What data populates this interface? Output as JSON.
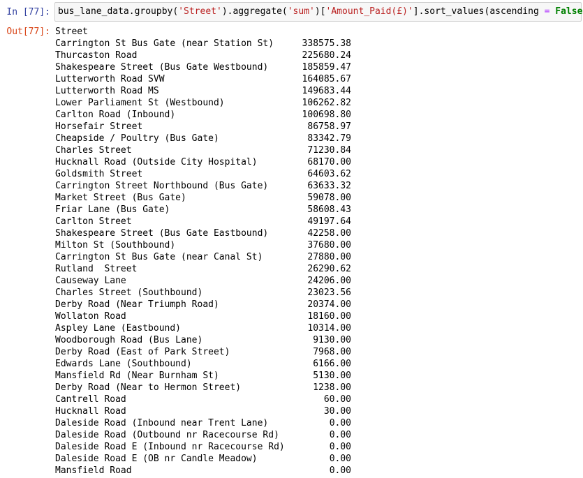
{
  "input_cell": {
    "prompt": "In [77]:",
    "code_parts": [
      {
        "t": "bus_lane_data.groupby(",
        "c": ""
      },
      {
        "t": "'Street'",
        "c": "str"
      },
      {
        "t": ").aggregate(",
        "c": ""
      },
      {
        "t": "'sum'",
        "c": "str"
      },
      {
        "t": ")[",
        "c": ""
      },
      {
        "t": "'Amount_Paid(£)'",
        "c": "str"
      },
      {
        "t": "].sort_values(ascending ",
        "c": ""
      },
      {
        "t": "=",
        "c": "op"
      },
      {
        "t": " ",
        "c": ""
      },
      {
        "t": "False",
        "c": "kw"
      },
      {
        "t": ")",
        "c": ""
      }
    ]
  },
  "output_cell": {
    "prompt": "Out[77]:",
    "index_name": "Street",
    "rows": [
      {
        "street": "Carrington St Bus Gate (near Station St)",
        "amount": "338575.38"
      },
      {
        "street": "Thurcaston Road",
        "amount": "225680.24"
      },
      {
        "street": "Shakespeare Street (Bus Gate Westbound)",
        "amount": "185859.47"
      },
      {
        "street": "Lutterworth Road SVW",
        "amount": "164085.67"
      },
      {
        "street": "Lutterworth Road MS",
        "amount": "149683.44"
      },
      {
        "street": "Lower Parliament St (Westbound)",
        "amount": "106262.82"
      },
      {
        "street": "Carlton Road (Inbound)",
        "amount": "100698.80"
      },
      {
        "street": "Horsefair Street",
        "amount": "86758.97"
      },
      {
        "street": "Cheapside / Poultry (Bus Gate)",
        "amount": "83342.79"
      },
      {
        "street": "Charles Street",
        "amount": "71230.84"
      },
      {
        "street": "Hucknall Road (Outside City Hospital)",
        "amount": "68170.00"
      },
      {
        "street": "Goldsmith Street",
        "amount": "64603.62"
      },
      {
        "street": "Carrington Street Northbound (Bus Gate)",
        "amount": "63633.32"
      },
      {
        "street": "Market Street (Bus Gate)",
        "amount": "59078.00"
      },
      {
        "street": "Friar Lane (Bus Gate)",
        "amount": "58608.43"
      },
      {
        "street": "Carlton Street",
        "amount": "49197.64"
      },
      {
        "street": "Shakespeare Street (Bus Gate Eastbound)",
        "amount": "42258.00"
      },
      {
        "street": "Milton St (Southbound)",
        "amount": "37680.00"
      },
      {
        "street": "Carrington St Bus Gate (near Canal St)",
        "amount": "27880.00"
      },
      {
        "street": "Rutland  Street",
        "amount": "26290.62"
      },
      {
        "street": "Causeway Lane",
        "amount": "24206.00"
      },
      {
        "street": "Charles Street (Southbound)",
        "amount": "23023.56"
      },
      {
        "street": "Derby Road (Near Triumph Road)",
        "amount": "20374.00"
      },
      {
        "street": "Wollaton Road",
        "amount": "18160.00"
      },
      {
        "street": "Aspley Lane (Eastbound)",
        "amount": "10314.00"
      },
      {
        "street": "Woodborough Road (Bus Lane)",
        "amount": "9130.00"
      },
      {
        "street": "Derby Road (East of Park Street)",
        "amount": "7968.00"
      },
      {
        "street": "Edwards Lane (Southbound)",
        "amount": "6166.00"
      },
      {
        "street": "Mansfield Rd (Near Burnham St)",
        "amount": "5130.00"
      },
      {
        "street": "Derby Road (Near to Hermon Street)",
        "amount": "1238.00"
      },
      {
        "street": "Cantrell Road",
        "amount": "60.00"
      },
      {
        "street": "Hucknall Road",
        "amount": "30.00"
      },
      {
        "street": "Daleside Road (Inbound near Trent Lane)",
        "amount": "0.00"
      },
      {
        "street": "Daleside Road (Outbound nr Racecourse Rd)",
        "amount": "0.00"
      },
      {
        "street": "Daleside Road E (Inbound nr Racecourse Rd)",
        "amount": "0.00"
      },
      {
        "street": "Daleside Road E (OB nr Candle Meadow)",
        "amount": "0.00"
      },
      {
        "street": "Mansfield Road",
        "amount": "0.00"
      }
    ]
  },
  "colors": {
    "prompt_in": "#303f9f",
    "prompt_out": "#d84315",
    "string": "#ba2121",
    "keyword": "#008000",
    "operator": "#aa22ff",
    "cell_bg": "#f7f7f7",
    "cell_border": "#cfcfcf"
  }
}
